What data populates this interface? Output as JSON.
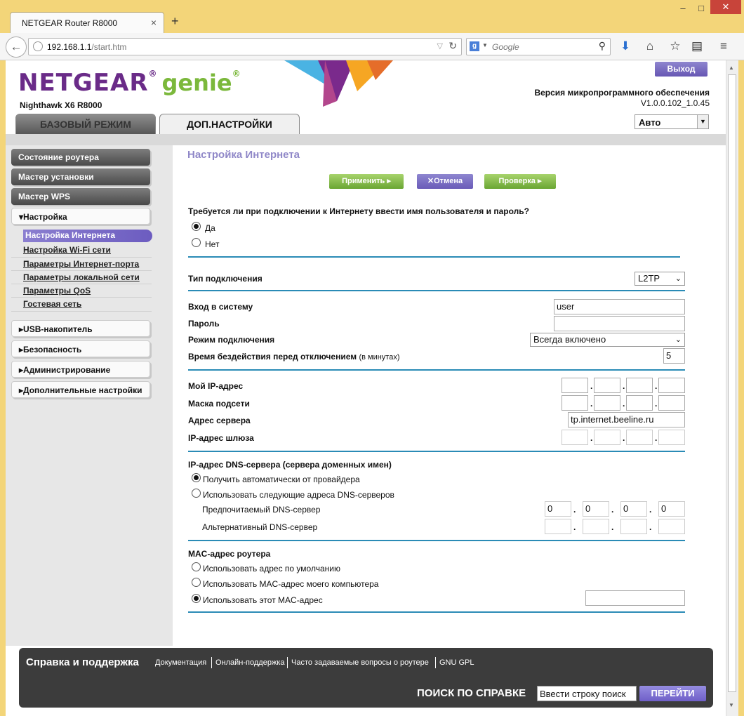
{
  "browser": {
    "tab_title": "NETGEAR Router R8000",
    "tab_close": "×",
    "new_tab": "+",
    "url_domain": "192.168.1.1",
    "url_path": "/start.htm",
    "search_placeholder": "Google",
    "search_engine_letter": "g",
    "win_minimize": "–",
    "win_restore": "□",
    "win_close": "✕"
  },
  "header": {
    "logo_text": "NETGEAR",
    "logo_reg": "®",
    "logo_genie": "genie",
    "logo_genie_reg": "®",
    "model": "Nighthawk X6 R8000",
    "logout": "Выход",
    "firmware_label": "Версия микропрограммного обеспечения",
    "firmware_version": "V1.0.0.102_1.0.45",
    "language": "Авто",
    "tab_basic": "БАЗОВЫЙ РЕЖИМ",
    "tab_advanced": "ДОП.НАСТРОЙКИ"
  },
  "sidebar": {
    "buttons": [
      "Состояние роутера",
      "Мастер установки",
      "Мастер WPS"
    ],
    "setup_label": "▾Настройка",
    "setup_items": [
      "Настройка Интернета",
      "Настройка Wi-Fi сети",
      "Параметры Интернет-порта",
      "Параметры локальной сети",
      "Параметры QoS",
      "Гостевая сеть"
    ],
    "collapsed": [
      "▸USB-накопитель",
      "▸Безопасность",
      "▸Администрирование",
      "▸Дополнительные настройки"
    ]
  },
  "content": {
    "title": "Настройка Интернета",
    "btn_apply": "Применить ▸",
    "btn_cancel": "✕Отмена",
    "btn_test": "Проверка ▸",
    "question": "Требуется ли при подключении к Интернету ввести имя пользователя и пароль?",
    "opt_yes": "Да",
    "opt_no": "Нет",
    "conn_type_label": "Тип подключения",
    "conn_type_value": "L2TP",
    "login_label": "Вход в систему",
    "login_value": "user",
    "password_label": "Пароль",
    "password_value": "",
    "conn_mode_label": "Режим подключения",
    "conn_mode_value": "Всегда включено",
    "idle_label": "Время бездействия перед отключением",
    "idle_unit": "(в минутах)",
    "idle_value": "5",
    "my_ip_label": "Мой IP-адрес",
    "subnet_label": "Маска подсети",
    "server_label": "Адрес сервера",
    "server_value": "tp.internet.beeline.ru",
    "gateway_label": "IP-адрес шлюза",
    "dns_title": "IP-адрес DNS-сервера (сервера доменных имен)",
    "dns_auto": "Получить автоматически от провайдера",
    "dns_manual": "Использовать следующие адреса DNS-серверов",
    "dns_primary_label": "Предпочитаемый DNS-сервер",
    "dns_primary": [
      "0",
      "0",
      "0",
      "0"
    ],
    "dns_secondary_label": "Альтернативный DNS-сервер",
    "mac_title": "MAC-адрес роутера",
    "mac_default": "Использовать адрес по умолчанию",
    "mac_computer": "Использовать MAC-адрес моего компьютера",
    "mac_this": "Использовать этот MAC-адрес",
    "ip_dot": "."
  },
  "footer": {
    "title": "Справка и поддержка",
    "links": [
      "Документация",
      "Онлайн-поддержка",
      "Часто задаваемые вопросы о роутере",
      "GNU GPL"
    ],
    "search_label": "ПОИСК ПО СПРАВКЕ",
    "search_placeholder": "Ввести строку поиск",
    "go": "ПЕРЕЙТИ"
  },
  "colors": {
    "accent_purple": "#6a5bb8",
    "accent_green": "#7bb83b",
    "divider_blue": "#2a8bb6"
  }
}
